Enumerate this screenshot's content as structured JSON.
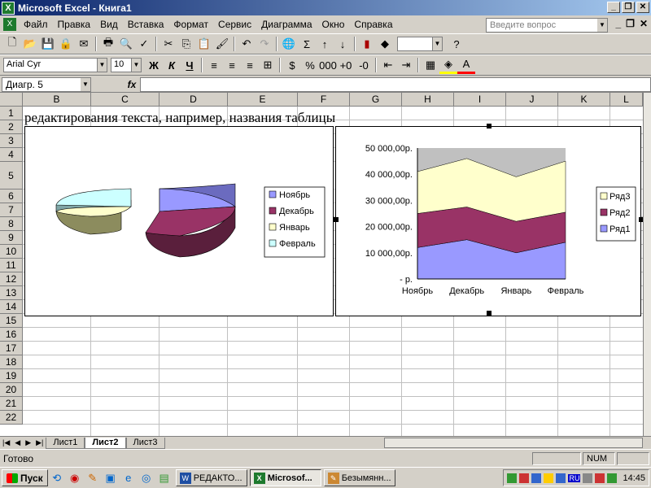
{
  "window": {
    "title": "Microsoft Excel - Книга1",
    "app_icon": "excel-icon"
  },
  "menu": [
    "Файл",
    "Правка",
    "Вид",
    "Вставка",
    "Формат",
    "Сервис",
    "Диаграмма",
    "Окно",
    "Справка"
  ],
  "help_box": {
    "placeholder": "Введите вопрос"
  },
  "formatting": {
    "font": "Arial Cyr",
    "size": "10",
    "bold": "Ж",
    "italic": "К",
    "underline": "Ч"
  },
  "formula_bar": {
    "name_box": "Диагр. 5",
    "fx_label": "fx",
    "value": ""
  },
  "grid": {
    "columns": [
      "B",
      "C",
      "D",
      "E",
      "F",
      "G",
      "H",
      "I",
      "J",
      "K",
      "L"
    ],
    "rows": [
      "1",
      "2",
      "3",
      "4",
      "5",
      "6",
      "7",
      "8",
      "9",
      "10",
      "11",
      "12",
      "13",
      "14",
      "15",
      "16",
      "17",
      "18",
      "19",
      "20",
      "21",
      "22"
    ],
    "row2_text": "редактирования текста, например, названия таблицы"
  },
  "sheets": {
    "tabs": [
      "Лист1",
      "Лист2",
      "Лист3"
    ],
    "active": "Лист2"
  },
  "status": {
    "text": "Готово",
    "num": "NUM"
  },
  "taskbar": {
    "start": "Пуск",
    "buttons": [
      {
        "label": "РЕДАКТО...",
        "icon": "word-icon",
        "active": false
      },
      {
        "label": "Microsof...",
        "icon": "excel-icon",
        "active": true
      },
      {
        "label": "Безымянн...",
        "icon": "paint-icon",
        "active": false
      }
    ],
    "tray_lang": "RU",
    "clock": "14:45"
  },
  "chart_data": [
    {
      "type": "pie",
      "title": "",
      "categories": [
        "Ноябрь",
        "Декабрь",
        "Январь",
        "Февраль"
      ],
      "values": [
        26,
        31,
        15,
        28
      ],
      "colors": [
        "#9999ff",
        "#993366",
        "#ffffcc",
        "#ccffff"
      ],
      "legend": "right",
      "style": "3d-exploded"
    },
    {
      "type": "area",
      "title": "",
      "stacked": true,
      "categories": [
        "Ноябрь",
        "Декабрь",
        "Январь",
        "Февраль"
      ],
      "series": [
        {
          "name": "Ряд1",
          "values": [
            12000,
            15000,
            10000,
            14000
          ],
          "color": "#9999ff"
        },
        {
          "name": "Ряд2",
          "values": [
            13000,
            12500,
            12000,
            11500
          ],
          "color": "#993366"
        },
        {
          "name": "Ряд3",
          "values": [
            16000,
            18500,
            17000,
            19500
          ],
          "color": "#ffffcc"
        }
      ],
      "total_fill": 50000,
      "total_color": "#c0c0c0",
      "ylim": [
        0,
        50000
      ],
      "yticks": [
        "-   р.",
        "10 000,00р.",
        "20 000,00р.",
        "30 000,00р.",
        "40 000,00р.",
        "50 000,00р."
      ],
      "legend": "right",
      "legend_order": [
        "Ряд3",
        "Ряд2",
        "Ряд1"
      ]
    }
  ]
}
